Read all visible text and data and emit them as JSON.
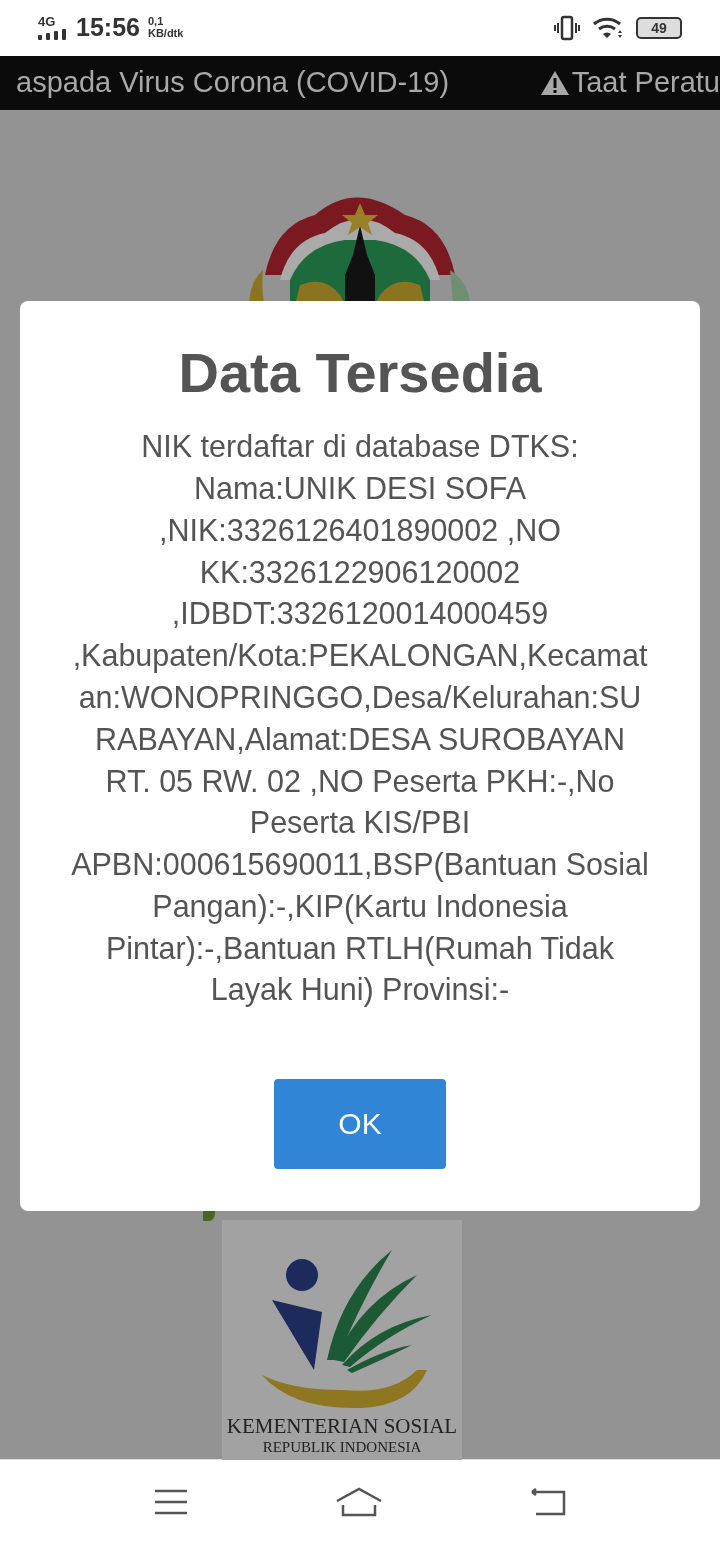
{
  "status_bar": {
    "network": "4G",
    "time": "15:56",
    "speed": "0,1",
    "speed_unit": "KB/dtk",
    "battery": "49"
  },
  "ticker": {
    "items": [
      "aspada Virus Corona (COVID-19)",
      "Taat Peratu"
    ]
  },
  "background": {
    "logo_caption": "KEMENTERIAN SOSIAL",
    "logo_subcaption": "REPUBLIK INDONESIA"
  },
  "dialog": {
    "title": "Data Tersedia",
    "message": "NIK terdaftar di database DTKS: Nama:UNIK DESI SOFA ,NIK:3326126401890002 ,NO KK:3326122906120002 ,IDBDT:3326120014000459 ,Kabupaten/Kota:PEKALONGAN,Kecamatan:WONOPRINGGO,Desa/Kelurahan:SURABAYAN,Alamat:DESA SUROBAYAN RT. 05 RW. 02 ,NO Peserta PKH:-,No Peserta KIS/PBI APBN:000615690011,BSP(Bantuan Sosial Pangan):-,KIP(Kartu Indonesia Pintar):-,Bantuan RTLH(Rumah Tidak Layak Huni) Provinsi:-",
    "button": "OK"
  }
}
